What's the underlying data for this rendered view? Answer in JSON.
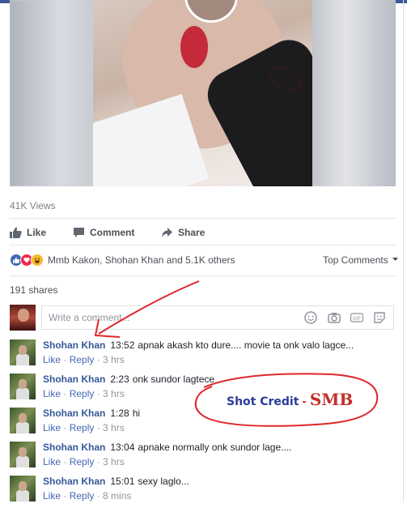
{
  "video": {
    "views": "41K Views"
  },
  "actions": {
    "like": "Like",
    "comment": "Comment",
    "share": "Share"
  },
  "reactions": {
    "names": "Mmb Kakon, Shohan Khan and 5.1K others",
    "top_comments": "Top Comments"
  },
  "shares": "191 shares",
  "composer": {
    "placeholder": "Write a comment..."
  },
  "comments": [
    {
      "name": "Shohan Khan",
      "time": "13:52",
      "text": "apnak akash kto dure.... movie ta onk valo lagce...",
      "like": "Like",
      "reply": "Reply",
      "age": "3 hrs"
    },
    {
      "name": "Shohan Khan",
      "time": "2:23",
      "text": "onk sundor lagtece",
      "like": "Like",
      "reply": "Reply",
      "age": "3 hrs"
    },
    {
      "name": "Shohan Khan",
      "time": "1:28",
      "text": "hi",
      "like": "Like",
      "reply": "Reply",
      "age": "3 hrs"
    },
    {
      "name": "Shohan Khan",
      "time": "13:04",
      "text": "apnake normally onk sundor lage....",
      "like": "Like",
      "reply": "Reply",
      "age": "3 hrs"
    },
    {
      "name": "Shohan Khan",
      "time": "15:01",
      "text": "sexy laglo...",
      "like": "Like",
      "reply": "Reply",
      "age": "8 mins"
    }
  ],
  "annotation": {
    "credit_label": "Shot Credit",
    "dash": "-",
    "credit_name": "SMB"
  },
  "colors": {
    "brand": "#3b5998",
    "link": "#365899",
    "annotation_red": "#e0262a"
  }
}
